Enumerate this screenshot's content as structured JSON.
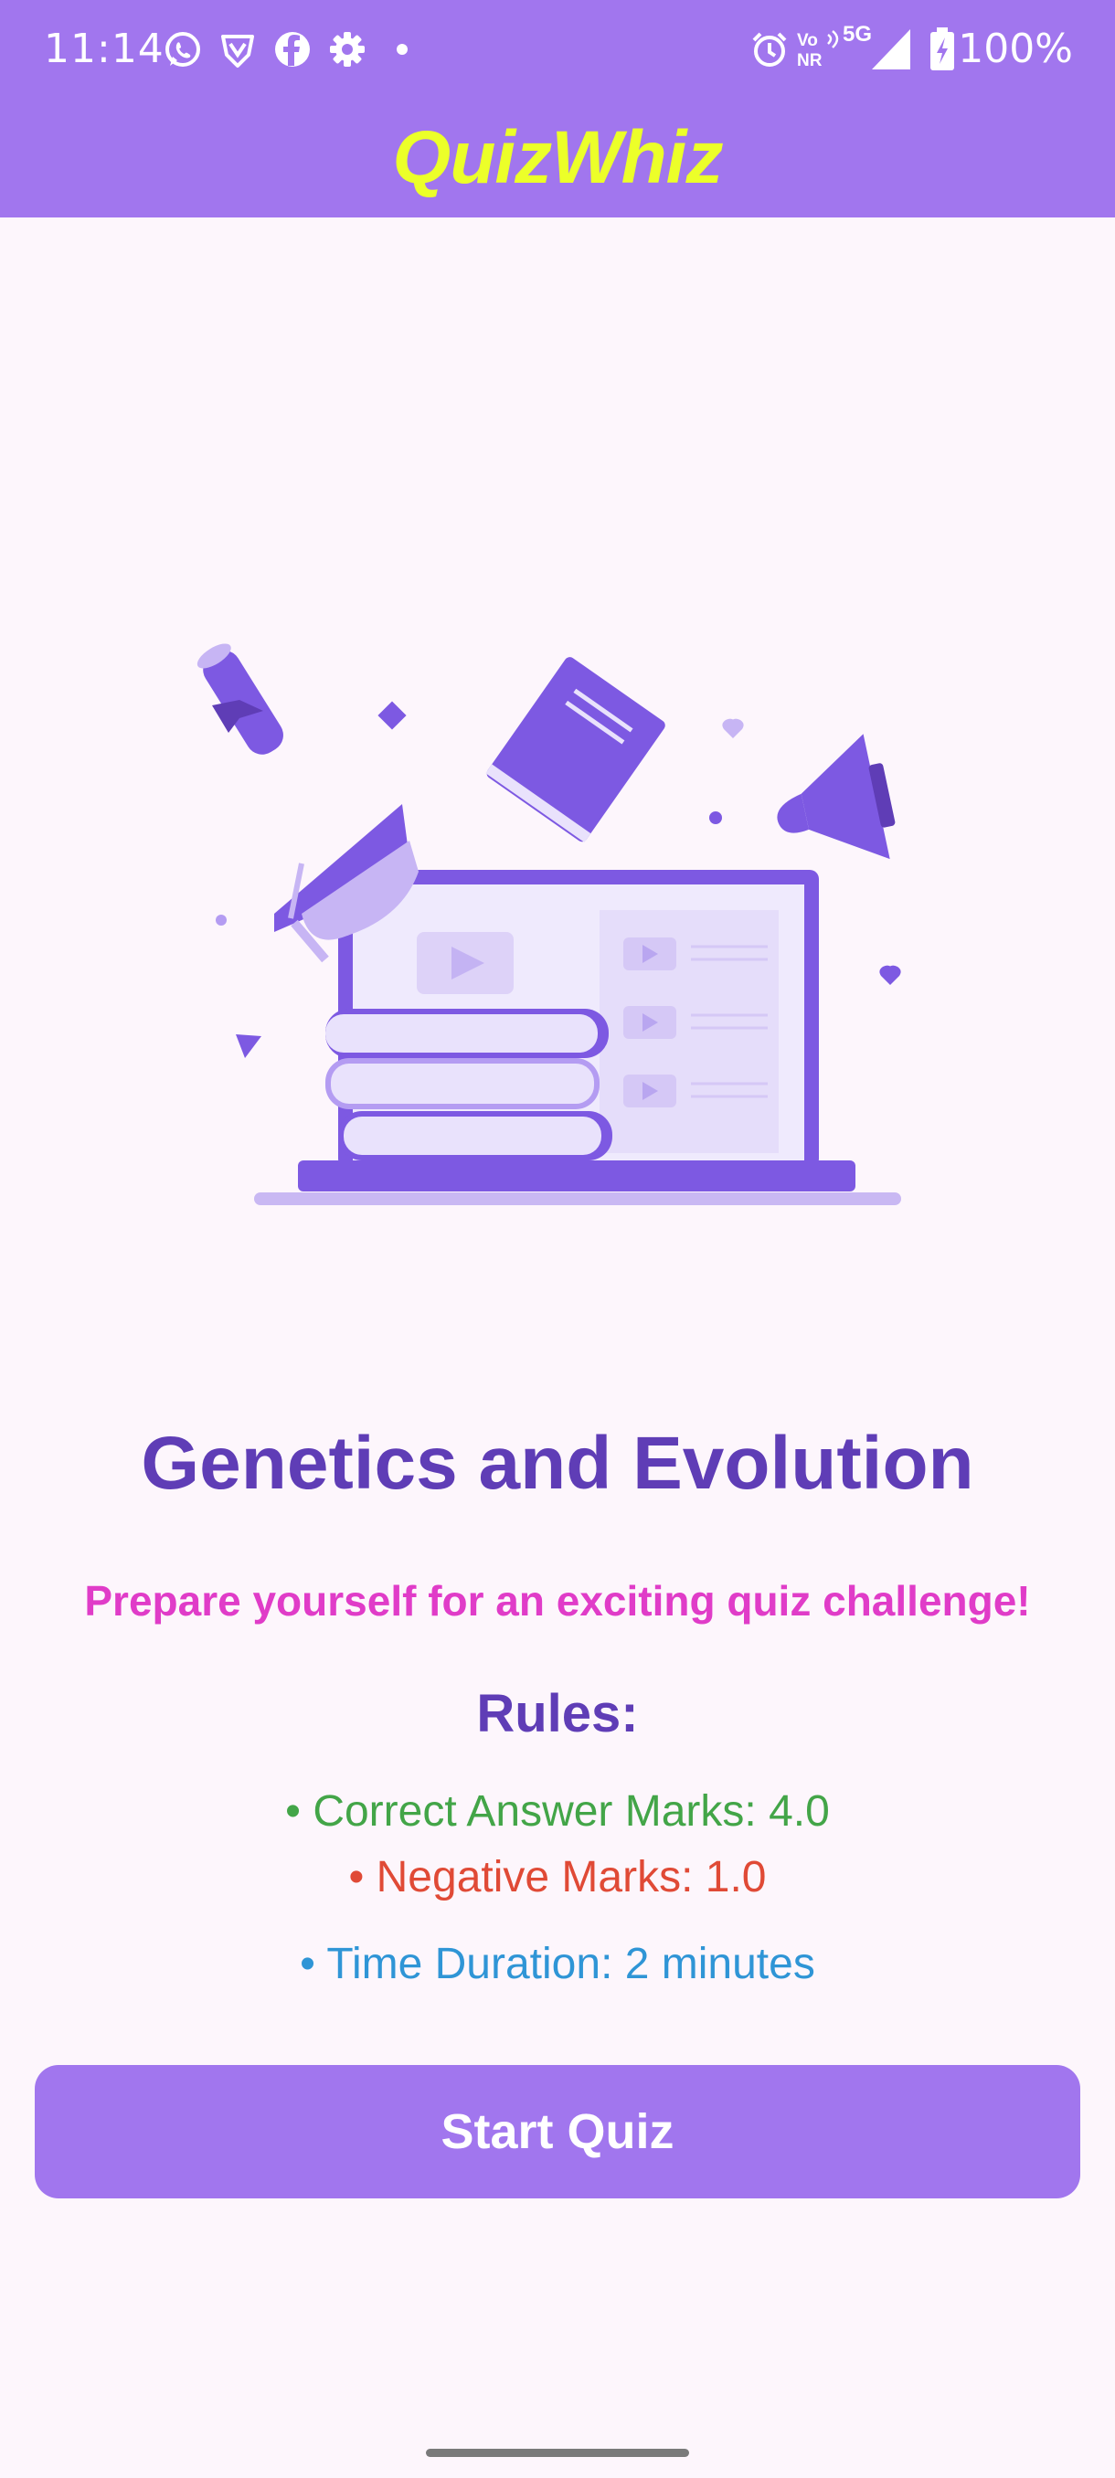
{
  "status_bar": {
    "time": "11:14",
    "network": "5G",
    "volte_top": "Vo",
    "volte_bottom": "NR",
    "battery": "100%",
    "left_icons": [
      "whatsapp-icon",
      "brave-icon",
      "facebook-icon",
      "settings-icon",
      "dot-icon"
    ],
    "right_icons": [
      "alarm-icon",
      "volte-icon",
      "signal-icon",
      "battery-charging-icon"
    ]
  },
  "app_bar": {
    "title": "QuizWhiz"
  },
  "quiz": {
    "title": "Genetics and Evolution",
    "tagline": "Prepare yourself for an exciting quiz challenge!",
    "rules_heading": "Rules:",
    "rules": {
      "correct": "• Correct Answer Marks: 4.0",
      "negative": "• Negative Marks: 1.0",
      "time": "• Time Duration: 2 minutes"
    },
    "start_label": "Start Quiz"
  },
  "colors": {
    "accent": "#a176ee",
    "title_yellow": "#ecff29",
    "heading_purple": "#5f3db6",
    "tagline_pink": "#e03cc8",
    "correct_green": "#43a548",
    "negative_red": "#e04a36",
    "time_blue": "#2f95d6",
    "background": "#fdf6fc"
  }
}
